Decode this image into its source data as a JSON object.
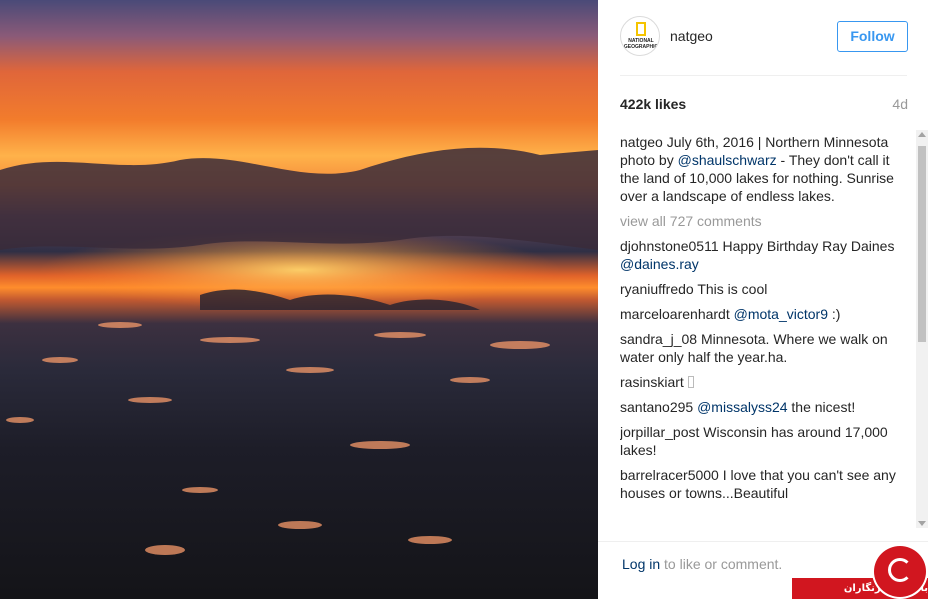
{
  "post": {
    "image_alt": "Sunrise over northern Minnesota lakes seen from above",
    "author": {
      "username": "natgeo",
      "avatar_text": "NATIONAL GEOGRAPHIC"
    },
    "follow_label": "Follow",
    "likes": "422k likes",
    "age": "4d",
    "caption": {
      "user": "natgeo",
      "text_1": " July 6th, 2016 | Northern Minnesota photo by ",
      "mention": "@shaulschwarz",
      "text_2": " - They don't call it the land of 10,000 lakes for nothing. Sunrise over a landscape of endless lakes."
    },
    "view_all": "view all 727 comments",
    "comments": [
      {
        "user": "djohnstone0511",
        "text": " Happy Birthday Ray Daines ",
        "mention": "@daines.ray",
        "after": ""
      },
      {
        "user": "ryaniuffredo",
        "text": " This is cool",
        "mention": "",
        "after": ""
      },
      {
        "user": "marceloarenhardt",
        "text": " ",
        "mention": "@mota_victor9",
        "after": " :)"
      },
      {
        "user": "sandra_j_08",
        "text": " Minnesota. Where we walk on water only half the year.ha.",
        "mention": "",
        "after": ""
      },
      {
        "user": "rasinskiart",
        "text": " ",
        "mention": "",
        "after": ""
      },
      {
        "user": "santano295",
        "text": " ",
        "mention": "@missalyss24",
        "after": " the nicest!"
      },
      {
        "user": "jorpillar_post",
        "text": " Wisconsin has around 17,000 lakes!",
        "mention": "",
        "after": ""
      },
      {
        "user": "barrelracer5000",
        "text": " I love that you can't see any houses or towns...Beautiful",
        "mention": "",
        "after": ""
      }
    ],
    "footer": {
      "login": "Log in",
      "rest": " to like or comment."
    }
  },
  "watermark": {
    "text": "باشگاه خبرنگاران"
  },
  "colors": {
    "accent": "#3897f0",
    "link": "#003569",
    "muted": "#999999",
    "watermark": "#d1161f"
  }
}
